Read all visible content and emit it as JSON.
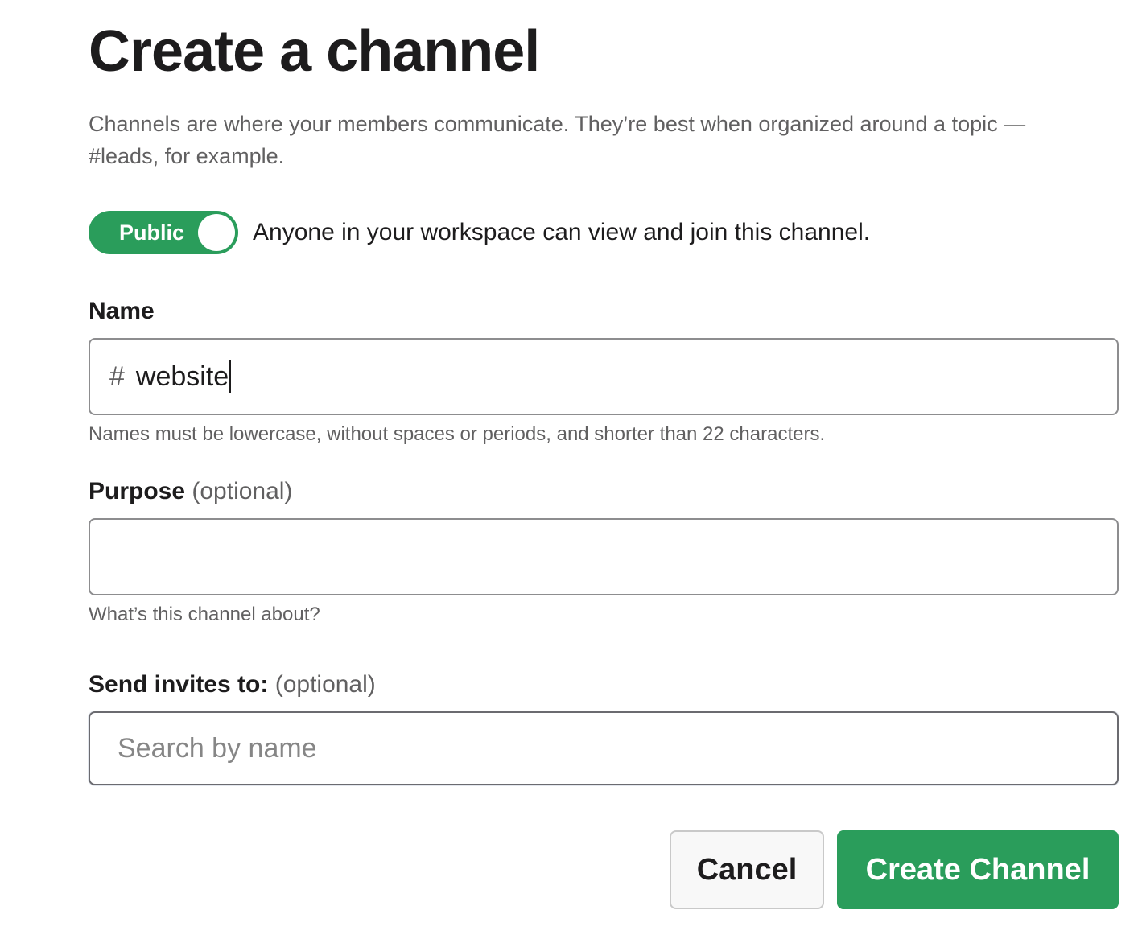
{
  "dialog": {
    "title": "Create a channel",
    "description": "Channels are where your members communicate. They’re best when organized around a topic — #leads, for example."
  },
  "visibility": {
    "toggle_label": "Public",
    "toggle_on": true,
    "description": "Anyone in your workspace can view and join this channel."
  },
  "name_field": {
    "label": "Name",
    "prefix": "#",
    "value": "website",
    "hint": "Names must be lowercase, without spaces or periods, and shorter than 22 characters."
  },
  "purpose_field": {
    "label": "Purpose",
    "optional": "(optional)",
    "value": "",
    "hint": "What’s this channel about?"
  },
  "invite_field": {
    "label": "Send invites to:",
    "optional": "(optional)",
    "placeholder": "Search by name"
  },
  "actions": {
    "cancel_label": "Cancel",
    "create_label": "Create Channel"
  },
  "colors": {
    "accent": "#2a9d5b",
    "text_primary": "#1d1c1d",
    "text_secondary": "#616061"
  },
  "icons": {
    "channel_prefix": "hash-icon"
  }
}
